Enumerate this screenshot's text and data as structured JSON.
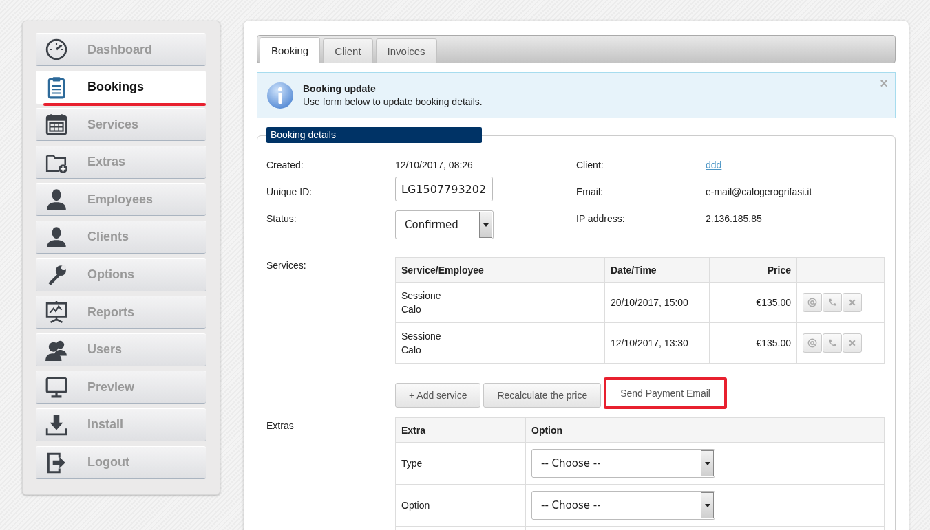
{
  "sidebar": {
    "items": [
      {
        "label": "Dashboard",
        "selected": false
      },
      {
        "label": "Bookings",
        "selected": true
      },
      {
        "label": "Services",
        "selected": false
      },
      {
        "label": "Extras",
        "selected": false
      },
      {
        "label": "Employees",
        "selected": false
      },
      {
        "label": "Clients",
        "selected": false
      },
      {
        "label": "Options",
        "selected": false
      },
      {
        "label": "Reports",
        "selected": false
      },
      {
        "label": "Users",
        "selected": false
      },
      {
        "label": "Preview",
        "selected": false
      },
      {
        "label": "Install",
        "selected": false
      },
      {
        "label": "Logout",
        "selected": false
      }
    ]
  },
  "tabs": [
    {
      "label": "Booking",
      "selected": true
    },
    {
      "label": "Client",
      "selected": false
    },
    {
      "label": "Invoices",
      "selected": false
    }
  ],
  "notice": {
    "title": "Booking update",
    "text": "Use form below to update booking details.",
    "close": "×"
  },
  "booking_details": {
    "legend": "Booking details",
    "left": [
      {
        "label": "Created:",
        "kind": "text",
        "value": "12/10/2017, 08:26"
      },
      {
        "label": "Unique ID:",
        "kind": "input",
        "value": "LG1507793202"
      },
      {
        "label": "Status:",
        "kind": "select",
        "value": "Confirmed"
      }
    ],
    "right": [
      {
        "label": "Client:",
        "kind": "link",
        "value": "ddd"
      },
      {
        "label": "Email:",
        "kind": "text",
        "value": "e-mail@calogerogrifasi.it"
      },
      {
        "label": "IP address:",
        "kind": "text",
        "value": "2.136.185.85"
      }
    ],
    "services": {
      "label": "Services:",
      "columns": [
        "Service/Employee",
        "Date/Time",
        "Price"
      ],
      "rows": [
        {
          "service": "Sessione",
          "employee": "Calo",
          "datetime": "20/10/2017, 15:00",
          "price": "€135.00"
        },
        {
          "service": "Sessione",
          "employee": "Calo",
          "datetime": "12/10/2017, 13:30",
          "price": "€135.00"
        }
      ]
    },
    "buttons": [
      {
        "label": "+ Add service",
        "highlighted": false
      },
      {
        "label": "Recalculate the price",
        "highlighted": false
      },
      {
        "label": "Send Payment Email",
        "highlighted": true
      }
    ],
    "extras": {
      "label": "Extras",
      "columns": [
        "Extra",
        "Option"
      ],
      "rows": [
        {
          "name": "Type",
          "value": "-- Choose --"
        },
        {
          "name": "Option",
          "value": "-- Choose --"
        }
      ]
    }
  }
}
